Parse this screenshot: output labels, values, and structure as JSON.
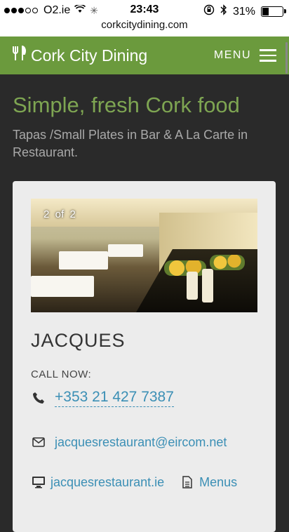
{
  "status_bar": {
    "carrier": "O2.ie",
    "time": "23:43",
    "battery": "31%",
    "url": "corkcitydining.com",
    "battery_level": 0.31,
    "signal_dots_filled": 3,
    "signal_dots_total": 5
  },
  "header": {
    "brand": "Cork City Dining",
    "menu_label": "MENU",
    "brand_icon": "fork-knife-icon",
    "bg_color": "#6b9a3d"
  },
  "hero": {
    "title": "Simple, fresh Cork food",
    "subtitle": "Tapas /Small Plates in Bar & A La Carte in Restaurant.",
    "title_color": "#7ea552"
  },
  "restaurant": {
    "photo_counter": "2  of  2",
    "name": "JACQUES",
    "call_label": "CALL NOW:",
    "phone": "+353 21 427 7387",
    "email": "jacquesrestaurant@eircom.net",
    "website": "jacquesrestaurant.ie",
    "menus_label": "Menus",
    "link_color": "#3b8fb5"
  }
}
